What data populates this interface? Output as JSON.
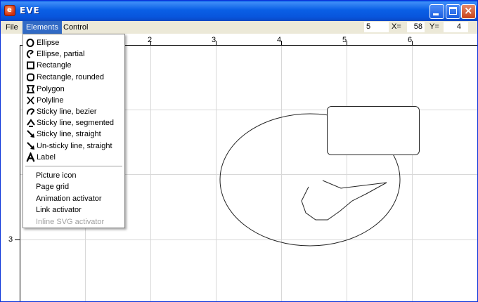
{
  "window": {
    "title": "EVE"
  },
  "menubar": {
    "file": "File",
    "elements": "Elements",
    "control": "Control"
  },
  "coords": {
    "zoom": "5",
    "x_label": "X=",
    "x_value": "58",
    "y_label": "Y=",
    "y_value": "4"
  },
  "ruler": {
    "top_ticks": [
      "2",
      "3",
      "4",
      "5",
      "6"
    ],
    "left_ticks": [
      "3"
    ]
  },
  "elements_menu": {
    "shapes": [
      {
        "label": "Ellipse",
        "icon": "ellipse-icon"
      },
      {
        "label": "Ellipse, partial",
        "icon": "ellipse-partial-icon"
      },
      {
        "label": "Rectangle",
        "icon": "rectangle-icon"
      },
      {
        "label": "Rectangle, rounded",
        "icon": "rounded-rectangle-icon"
      },
      {
        "label": "Polygon",
        "icon": "polygon-icon"
      },
      {
        "label": "Polyline",
        "icon": "polyline-icon"
      },
      {
        "label": "Sticky line, bezier",
        "icon": "bezier-line-icon"
      },
      {
        "label": "Sticky line, segmented",
        "icon": "segmented-line-icon"
      },
      {
        "label": "Sticky line, straight",
        "icon": "straight-line-icon"
      },
      {
        "label": "Un-sticky line, straight",
        "icon": "unsticky-line-icon"
      },
      {
        "label": "Label",
        "icon": "label-icon"
      }
    ],
    "extras": [
      {
        "label": "Picture icon",
        "enabled": true
      },
      {
        "label": "Page grid",
        "enabled": true
      },
      {
        "label": "Animation activator",
        "enabled": true
      },
      {
        "label": "Link activator",
        "enabled": true
      },
      {
        "label": "Inline SVG activator",
        "enabled": false
      }
    ]
  }
}
